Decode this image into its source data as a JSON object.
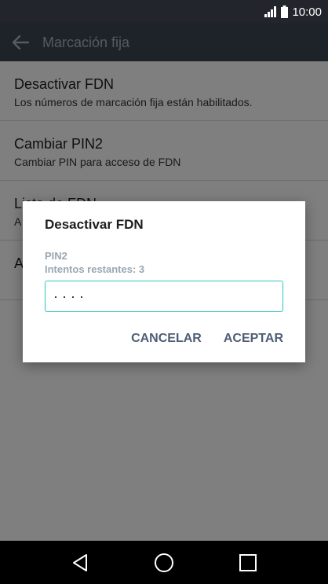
{
  "status_bar": {
    "time": "10:00",
    "icons": [
      "signal-icon",
      "battery-icon"
    ]
  },
  "app_bar": {
    "title": "Marcación fija",
    "back_icon": "arrow-left-icon"
  },
  "settings": [
    {
      "title": "Desactivar FDN",
      "subtitle": "Los números de marcación fija están habilitados."
    },
    {
      "title": "Cambiar PIN2",
      "subtitle": "Cambiar PIN para acceso de FDN"
    },
    {
      "title": "Lista de FDN",
      "subtitle": "A"
    },
    {
      "title": "A",
      "subtitle": ""
    }
  ],
  "dialog": {
    "title": "Desactivar FDN",
    "field_label": "PIN2",
    "attempts": "Intentos restantes: 3",
    "pin_value": "····",
    "cancel_label": "CANCELAR",
    "accept_label": "ACEPTAR",
    "accent_color": "#2fc7c0"
  },
  "nav_bar": {
    "icons": [
      "back-triangle-icon",
      "home-circle-icon",
      "recents-square-icon"
    ]
  }
}
